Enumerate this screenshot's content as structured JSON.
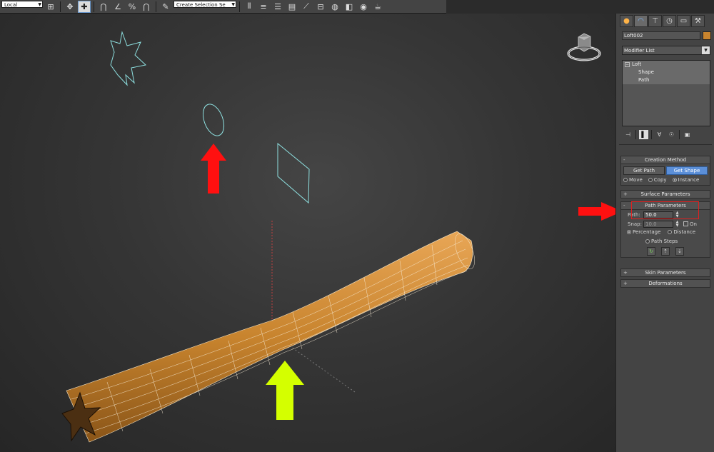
{
  "toolbar": {
    "coord_dropdown": "Local",
    "selection_set_dropdown": "Create Selection Se"
  },
  "viewport": {
    "annotations": {
      "circle_arrow_color": "#ff1010",
      "panel_arrow_color": "#ff1010",
      "loft_arrow_color": "#d4ff00"
    },
    "loft_color": "#c8842e"
  },
  "command_panel": {
    "tabs": [
      "create-icon",
      "modify-icon",
      "hierarchy-icon",
      "motion-icon",
      "display-icon",
      "utilities-icon"
    ],
    "object_name": "Loft002",
    "object_color": "#c8842e",
    "modifier_list_label": "Modifier List",
    "stack": {
      "root": "Loft",
      "children": [
        "Shape",
        "Path"
      ]
    },
    "creation_method": {
      "title": "Creation Method",
      "get_path": "Get Path",
      "get_shape": "Get Shape",
      "radio_move": "Move",
      "radio_copy": "Copy",
      "radio_instance": "Instance"
    },
    "surface_parameters": "Surface Parameters",
    "path_parameters": {
      "title": "Path Parameters",
      "path_label": "Path:",
      "path_value": "50.0",
      "snap_label": "Snap:",
      "snap_value": "10.0",
      "on_label": "On",
      "percentage": "Percentage",
      "distance": "Distance",
      "path_steps": "Path Steps"
    },
    "skin_parameters": "Skin Parameters",
    "deformations": "Deformations",
    "toggle_minus": "-",
    "toggle_plus": "+"
  }
}
